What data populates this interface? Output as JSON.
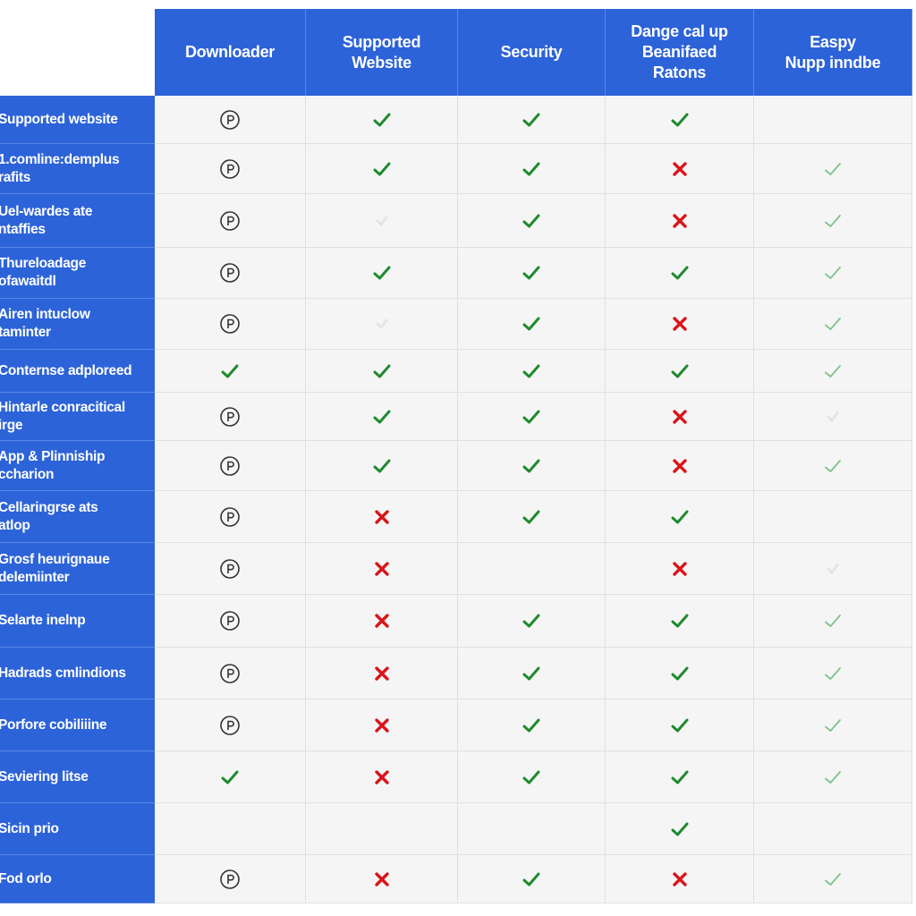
{
  "table": {
    "columns": [
      {
        "label": "Downloader"
      },
      {
        "label": "Supported\nWebsite"
      },
      {
        "label": "Security"
      },
      {
        "label": "Dange cal up\nBeanifaed\nRatons"
      },
      {
        "label": "Easpy\nNupp inndbe"
      }
    ],
    "rows": [
      {
        "label": "Supported website",
        "cells": [
          "p",
          "check",
          "check",
          "check",
          "empty"
        ]
      },
      {
        "label": "1.comline:demplus\nrafits",
        "cells": [
          "p",
          "check",
          "check",
          "x",
          "check-light"
        ]
      },
      {
        "label": "Uel-wardes ate\nntaffies",
        "cells": [
          "p",
          "faint",
          "check",
          "x",
          "check-light"
        ]
      },
      {
        "label": "Thureloadage\nofawaitdl",
        "cells": [
          "p",
          "check",
          "check",
          "check",
          "check-light"
        ]
      },
      {
        "label": "Airen intuclow\ntaminter",
        "cells": [
          "p",
          "faint",
          "check",
          "x",
          "check-light"
        ]
      },
      {
        "label": "Conternse adploreed",
        "cells": [
          "check",
          "check",
          "check",
          "check",
          "check-light"
        ]
      },
      {
        "label": "Hintarle conracitical\nirge",
        "cells": [
          "p",
          "check",
          "check",
          "x",
          "faint"
        ]
      },
      {
        "label": "App & Plinniship\nccharion",
        "cells": [
          "p",
          "check",
          "check",
          "x",
          "check-light"
        ]
      },
      {
        "label": "Cellaringrse ats\natlop",
        "cells": [
          "p",
          "x",
          "check",
          "check",
          "empty"
        ]
      },
      {
        "label": "Grosf heurignaue\ndelemiinter",
        "cells": [
          "p",
          "x",
          "empty",
          "x",
          "faint"
        ]
      },
      {
        "label": "Selarte inelnp",
        "cells": [
          "p",
          "x",
          "check",
          "check",
          "check-light"
        ]
      },
      {
        "label": "Hadrads cmlindions",
        "cells": [
          "p",
          "x",
          "check",
          "check",
          "check-light"
        ]
      },
      {
        "label": "Porfore cobiliiine",
        "cells": [
          "p",
          "x",
          "check",
          "check",
          "check-light"
        ]
      },
      {
        "label": "Seviering litse",
        "cells": [
          "check",
          "x",
          "check",
          "check",
          "check-light"
        ]
      },
      {
        "label": "Sicin prio",
        "cells": [
          "empty",
          "empty",
          "empty",
          "check",
          "empty"
        ]
      },
      {
        "label": "Fod orlo",
        "cells": [
          "p",
          "x",
          "check",
          "x",
          "check-light"
        ]
      }
    ]
  },
  "icons": {
    "p": "circle-p-icon",
    "check": "checkmark-icon",
    "check-light": "checkmark-light-icon",
    "x": "cross-icon",
    "faint": "faded-mark-icon",
    "empty": ""
  },
  "colors": {
    "header_blue": "#2d63d8",
    "check_green": "#1f8a2e",
    "check_light_green": "#7fc28a",
    "cross_red": "#d9151b",
    "icon_dark": "#333333"
  }
}
